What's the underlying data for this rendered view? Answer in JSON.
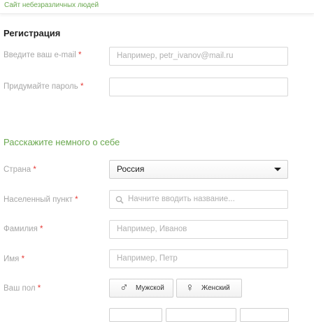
{
  "header": {
    "site_link": "Сайт небезразличных людей"
  },
  "registration": {
    "title": "Регистрация",
    "email": {
      "label": "Введите ваш e-mail",
      "required": "*",
      "placeholder": "Например, petr_ivanov@mail.ru"
    },
    "password": {
      "label": "Придумайте пароль",
      "required": "*",
      "value": ""
    }
  },
  "about": {
    "title": "Расскажите немного о себе",
    "country": {
      "label": "Страна",
      "required": "*",
      "value": "Россия"
    },
    "city": {
      "label": "Населенный пункт",
      "required": "*",
      "placeholder": "Начните вводить название..."
    },
    "last_name": {
      "label": "Фамилия",
      "required": "*",
      "placeholder": "Например, Иванов"
    },
    "first_name": {
      "label": "Имя",
      "required": "*",
      "placeholder": "Например, Петр"
    },
    "gender": {
      "label": "Ваш пол",
      "required": "*",
      "male": "Мужской",
      "female": "Женский",
      "male_symbol": "♂",
      "female_symbol": "♀"
    }
  },
  "colors": {
    "accent": "#6aa84f",
    "required": "#e53935",
    "label": "#a7a7a7"
  },
  "icons": {
    "search": "search-icon",
    "dropdown": "chevron-down-icon",
    "male": "male-icon",
    "female": "female-icon"
  }
}
